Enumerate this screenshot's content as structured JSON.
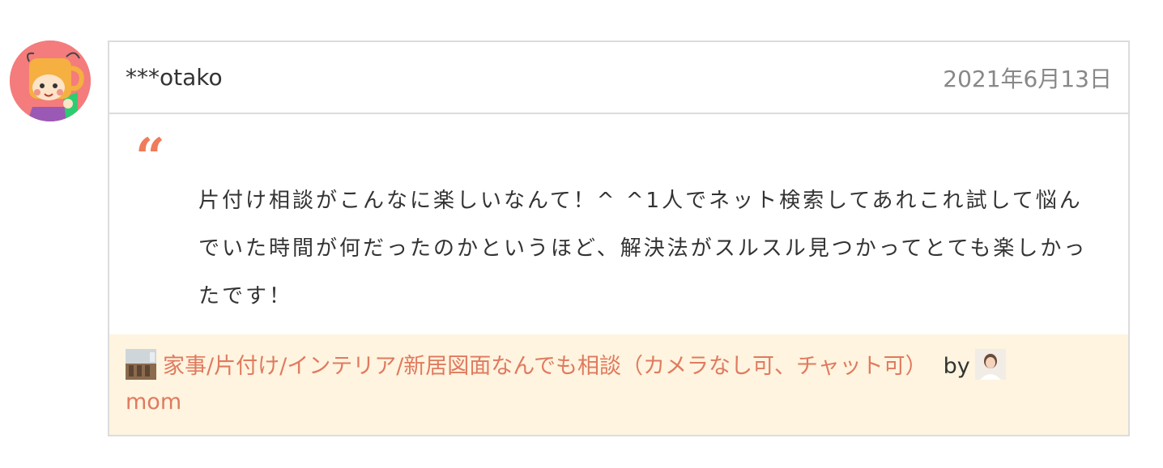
{
  "review": {
    "username": "***otako",
    "date": "2021年6月13日",
    "quote_mark": "“",
    "comment": "片付け相談がこんなに楽しいなんて！^ ^1人でネット検索してあれこれ試して悩んでいた時間が何だったのかというほど、解決法がスルスル見つかってとても楽しかったです！"
  },
  "footer": {
    "service_title": "家事/片付け/インテリア/新居図面なんでも相談（カメラなし可、チャット可）",
    "by_label": "by",
    "author_name": "mom"
  },
  "colors": {
    "accent": "#e07a5f",
    "footer_bg": "#fef4df",
    "avatar_bg": "#f47c7c",
    "border": "#dcdcdc"
  },
  "icons": {
    "avatar": "cartoon-cup-character",
    "service_thumb": "room-photo-thumbnail",
    "author_avatar": "person-photo"
  }
}
